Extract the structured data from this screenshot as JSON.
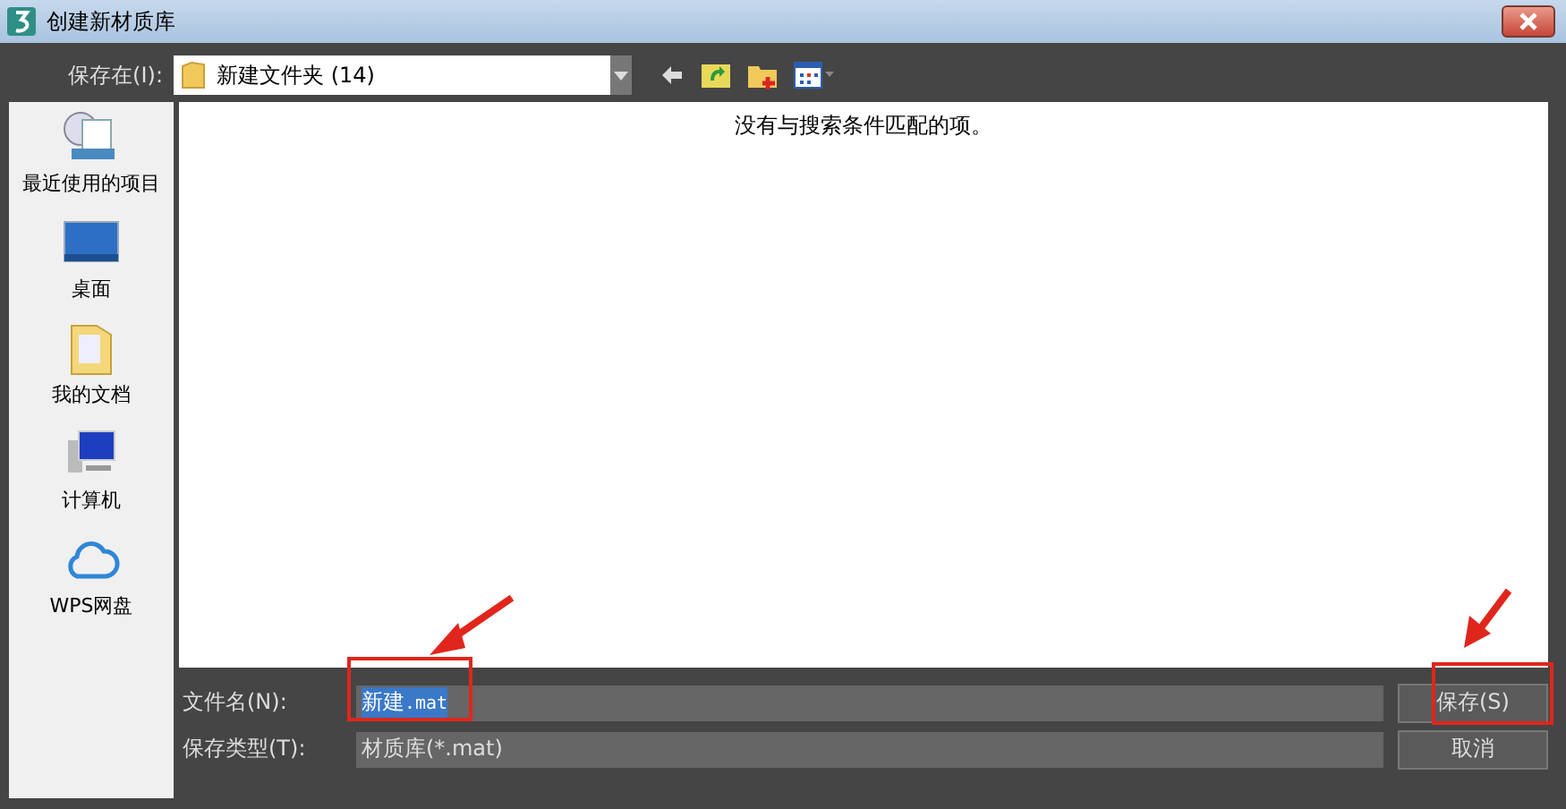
{
  "window": {
    "title": "创建新材质库"
  },
  "save_in": {
    "label": "保存在(I):",
    "value": "新建文件夹 (14)"
  },
  "places": [
    {
      "label": "最近使用的项目",
      "kind": "recent"
    },
    {
      "label": "桌面",
      "kind": "desktop"
    },
    {
      "label": "我的文档",
      "kind": "documents"
    },
    {
      "label": "计算机",
      "kind": "computer"
    },
    {
      "label": "WPS网盘",
      "kind": "cloud"
    }
  ],
  "file_list": {
    "empty_message": "没有与搜索条件匹配的项。"
  },
  "file_name": {
    "label": "文件名(N):",
    "value_name": "新建",
    "value_ext": ".mat",
    "selected": true
  },
  "file_type": {
    "label": "保存类型(T):",
    "value": "材质库(*.mat)"
  },
  "buttons": [
    "保存(S)",
    "取消"
  ]
}
